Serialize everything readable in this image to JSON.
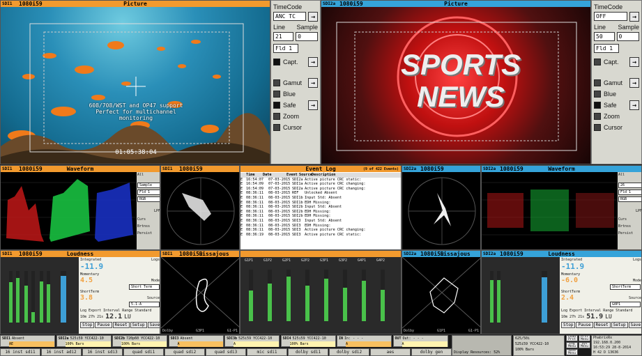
{
  "picture_left": {
    "source": "SDI1",
    "format": "1080i59",
    "title": "Picture",
    "caption": "608/708/WST and OP47 support\nPerfect for multichannel\nmonitoring",
    "timecode": "01:05:38:04"
  },
  "picture_right": {
    "source": "SDI2a",
    "format": "1080i59",
    "title": "Picture",
    "overlay": "SPORTS NEWS"
  },
  "side_left": {
    "timecode_label": "TimeCode",
    "timecode_value": "ANC TC",
    "line_label": "Line",
    "sample_label": "Sample",
    "line_value": "21",
    "sample_value": "0",
    "field_value": "Fld 1",
    "capt": "Capt.",
    "gamut": "Gamut",
    "blue": "Blue",
    "safe": "Safe",
    "zoom": "Zoom",
    "cursor": "Cursor"
  },
  "side_right": {
    "timecode_label": "TimeCode",
    "timecode_value": "OFF",
    "line_label": "Line",
    "sample_label": "Sample",
    "line_value": "50",
    "sample_value": "0",
    "field_value": "Fld 1",
    "capt": "Capt.",
    "gamut": "Gamut",
    "blue": "Blue",
    "safe": "Safe",
    "zoom": "Zoom",
    "cursor": "Cursor"
  },
  "waveform_left": {
    "source": "SDI1",
    "format": "1080i59",
    "title": "Waveform",
    "line": "All",
    "sample": "Sample",
    "fld": "Fld 1",
    "mode": "RGB",
    "lpf": "LPF",
    "cursor": "Curs",
    "brt": "Brtnss",
    "persist": "Persist",
    "gain": "Gain"
  },
  "vector_left": {
    "source": "SDI1",
    "format": "1080i59"
  },
  "event_log": {
    "title": "Event Log",
    "count": "(9 of 422 Events)",
    "headers": [
      "Time",
      "Date",
      "Event",
      "Source",
      "Description"
    ],
    "rows": [
      [
        "E",
        "16:54:07",
        "07-03-2015",
        "SDI2a",
        "Active picture CRC static:"
      ],
      [
        "E",
        "16:54:09",
        "07-03-2015",
        "SDI1a",
        "Active picture CRC changing:"
      ],
      [
        "E",
        "16:54:09",
        "07-03-2015",
        "SDI2a",
        "Active picture CRC changing:"
      ],
      [
        "E",
        "08:36:11",
        "08-03-2015",
        "REF",
        "Unlocked Absent"
      ],
      [
        "E",
        "08:36:11",
        "08-03-2015",
        "SDI1b",
        "Input Std: Absent"
      ],
      [
        "E",
        "08:36:11",
        "08-03-2015",
        "SDI1b",
        "EDH Missing:"
      ],
      [
        "E",
        "08:36:11",
        "08-03-2015",
        "SDI2b",
        "Input Std: Absent"
      ],
      [
        "E",
        "08:36:11",
        "08-03-2015",
        "SDI2b",
        "EDH Missing:"
      ],
      [
        "E",
        "08:36:11",
        "08-03-2015",
        "SDI2b",
        "EDH Missing:"
      ],
      [
        "E",
        "08:36:11",
        "08-03-2015",
        "SDI3",
        "Input Std: Absent"
      ],
      [
        "E",
        "08:36:11",
        "08-03-2015",
        "SDI3",
        "EDH Missing:"
      ],
      [
        "E",
        "08:36:11",
        "08-03-2015",
        "SDI3",
        "Active picture CRC changing:"
      ],
      [
        "E",
        "08:36:19",
        "08-03-2015",
        "SDI3",
        "Active picture CRC static:"
      ]
    ]
  },
  "vector_right": {
    "source": "SDI2a",
    "format": "1080i59"
  },
  "waveform_right": {
    "source": "SDI2a",
    "format": "1080i59",
    "title": "Waveform",
    "line": "All",
    "sample": "26",
    "fld": "Fld 1",
    "mode": "RGB",
    "lpf": "LPF",
    "cursor": "Curs",
    "brt": "Brtnss",
    "persist": "Persist",
    "gain": "Gain"
  },
  "loudness_left": {
    "source": "SDI1",
    "format": "1080i59",
    "title": "Loudness",
    "integrated_label": "Integrated",
    "integrated": "-11.9",
    "momentary_label": "Momentary",
    "momentary": "4.5",
    "shortterm_label": "ShortTerm",
    "shortterm": "3.8",
    "errors1": "Errors 0",
    "errors2": "Errors 25",
    "errors3": "Errors 0",
    "thld": "Thld 4",
    "mode_label": "Mode",
    "mode": "Short Term",
    "source_label": "Source",
    "source_value": "5.1-A",
    "logs": "Logs",
    "range_label": "Range",
    "range": "12.1",
    "standard": "Standard",
    "unit": "LU",
    "log_export": "Log Export",
    "interval": "Interval",
    "interval_value": "10m 27h 21s",
    "buttons": [
      "Stop",
      "Pause",
      "Reset",
      "Setup",
      "Save"
    ],
    "channels": [
      "L",
      "R",
      "C",
      "Lfe",
      "Ls",
      "Rs"
    ]
  },
  "lissajous_left": {
    "source": "SDI1",
    "format": "1080i59",
    "title": "Lissajous",
    "left_label": "Dolby",
    "pair": "G3P1",
    "right_label": "G1-P1"
  },
  "audio_middle": {
    "channels": [
      "G1P1",
      "G1P2",
      "G2P1",
      "G2P2",
      "G3P1",
      "G3P2",
      "G4P1",
      "G4P2"
    ]
  },
  "lissajous_right": {
    "source": "SDI2a",
    "format": "1080i59",
    "title": "Lissajous",
    "left_label": "Dolby",
    "pair": "G1P1",
    "right_label": "G1-P1"
  },
  "loudness_right": {
    "source": "SDI2a",
    "format": "1080i59",
    "title": "Loudness",
    "integrated_label": "Integrated",
    "integrated": "-11.9",
    "momentary_label": "Momentary",
    "momentary": "-6.0",
    "shortterm_label": "ShortTerm",
    "shortterm": "2.4",
    "errors1": "Errors 0",
    "errors2": "Errors 0",
    "errors3": "Errors 0",
    "thld": "Thld 4",
    "mode_label": "Mode",
    "mode": "ShortTerm",
    "source_label": "Source",
    "source_value": "G0P1",
    "logs": "Logs",
    "range_label": "Range",
    "range": "51.9",
    "standard": "Standard",
    "unit": "LU",
    "log_export": "Log Export",
    "interval": "Interval",
    "interval_value": "10m 27h 21s",
    "buttons": [
      "Stop",
      "Pause",
      "Reset",
      "Setup",
      "Save"
    ]
  },
  "status": [
    {
      "id": "SDI1",
      "a": "Absent",
      "b": "AE"
    },
    {
      "id": "SDI2a",
      "a": "525i59 YCC422-10",
      "b": "100% Bars"
    },
    {
      "id": "SDI2b",
      "a": "720p60 YCC422-10",
      "b": "100% Bars"
    },
    {
      "id": "SDI3",
      "a": "Absent",
      "b": "A"
    },
    {
      "id": "SDI3b",
      "a": "525i59 YCC422-10",
      "b": "A"
    },
    {
      "id": "SDI4",
      "a": "525i59 YCC422-10",
      "b": "100% Bars"
    },
    {
      "id": "IN",
      "a": "In: - - -",
      "b": "A"
    },
    {
      "id": "OUT",
      "a": "Out: - - -",
      "b": "A"
    }
  ],
  "ref_status": {
    "ref": "625/50i",
    "ref2": "525i59 YCC422-10",
    "id": "100% Bars",
    "display": "Display Resources: 52%"
  },
  "tabs": [
    "16 inst sdi1",
    "16 inst adi2",
    "16 inst sdi3",
    "quad sdi1",
    "quad sdi2",
    "quad sdi3",
    "mic sdi1",
    "dolby sdi1",
    "dolby sdi2",
    "aes",
    "dolby gen"
  ],
  "right_buttons": [
    "Load Prst",
    "Prst Menu",
    "Log Menu",
    "Sys Menu",
    "Save Menu"
  ],
  "system": {
    "brand": "PhabrixRx",
    "ip": "192.168.0.200",
    "time": "16:53:29 28-8-2014",
    "temp": "H 42  D 13636"
  }
}
